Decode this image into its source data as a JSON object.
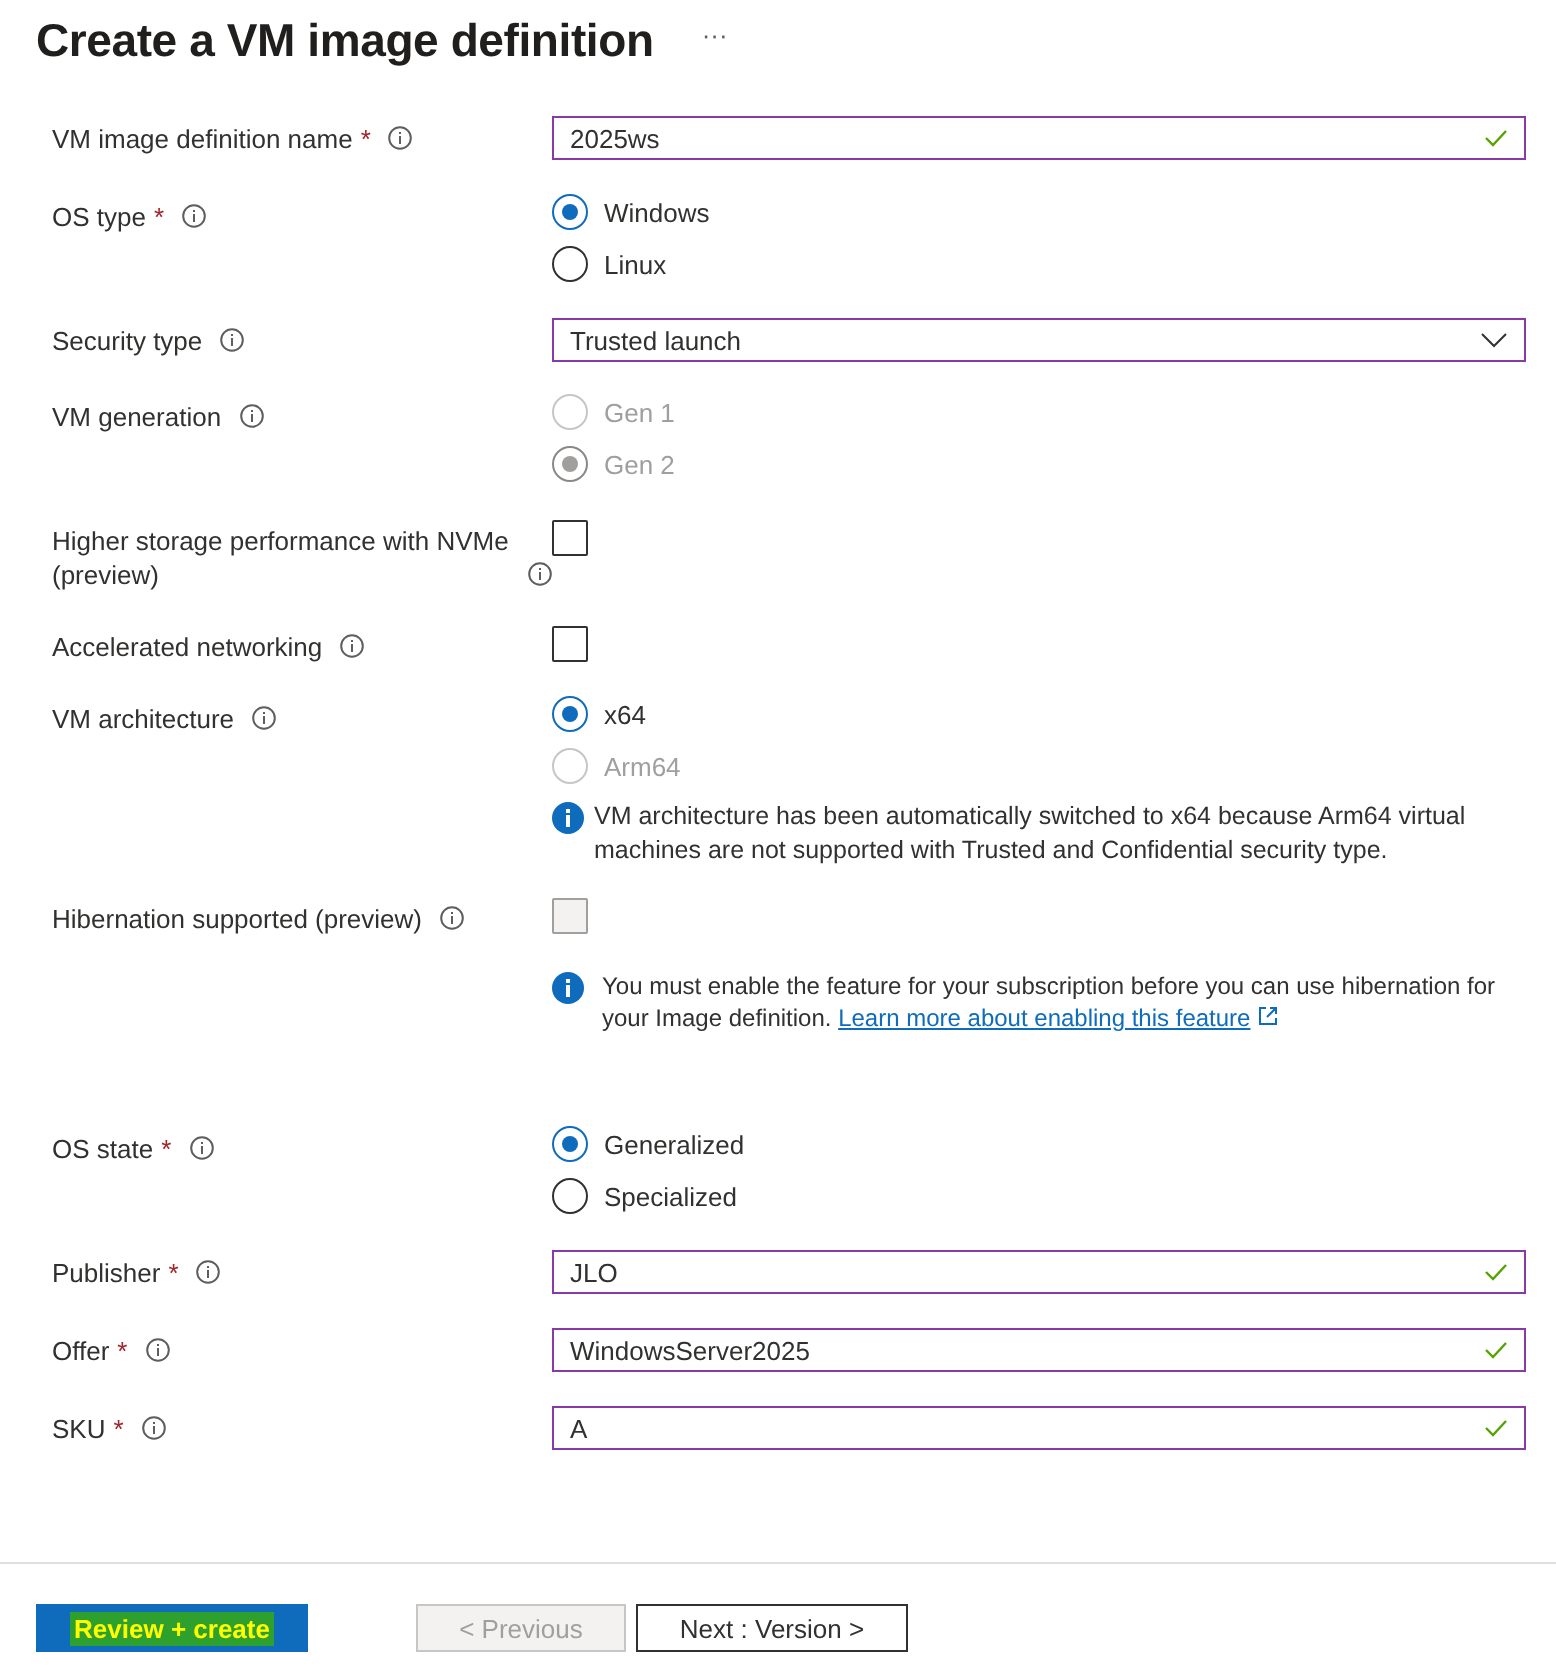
{
  "title": "Create a VM image definition",
  "more": "···",
  "fields": [
    {
      "kind": "text",
      "label": "VM image definition name",
      "required_mark": "*",
      "value": "2025ws",
      "valid": true
    },
    {
      "kind": "radio",
      "label": "OS type",
      "required_mark": "*",
      "options": [
        {
          "label": "Windows",
          "selected": true,
          "disabled": false
        },
        {
          "label": "Linux",
          "selected": false,
          "disabled": false
        }
      ]
    },
    {
      "kind": "select",
      "label": "Security type",
      "value": "Trusted launch"
    },
    {
      "kind": "radio",
      "label": "VM generation",
      "options": [
        {
          "label": "Gen 1",
          "selected": false,
          "disabled": true
        },
        {
          "label": "Gen 2",
          "selected": true,
          "disabled": true
        }
      ]
    },
    {
      "kind": "checkbox",
      "label": "Higher storage performance with NVMe (preview)",
      "checked": false,
      "disabled": false
    },
    {
      "kind": "checkbox",
      "label": "Accelerated networking",
      "checked": false,
      "disabled": false
    },
    {
      "kind": "radio",
      "label": "VM architecture",
      "options": [
        {
          "label": "x64",
          "selected": true,
          "disabled": false
        },
        {
          "label": "Arm64",
          "selected": false,
          "disabled": true
        }
      ],
      "note": {
        "text": "VM architecture has been automatically switched to x64 because Arm64 virtual machines are not supported with Trusted and Confidential security type."
      }
    },
    {
      "kind": "checkbox",
      "label": "Hibernation supported (preview)",
      "checked": false,
      "disabled": true,
      "note": {
        "text": "You must enable the feature for your subscription before you can use hibernation for your Image definition.",
        "link": "Learn more about enabling this feature"
      }
    },
    {
      "kind": "radio",
      "label": "OS state",
      "required_mark": "*",
      "options": [
        {
          "label": "Generalized",
          "selected": true,
          "disabled": false
        },
        {
          "label": "Specialized",
          "selected": false,
          "disabled": false
        }
      ]
    },
    {
      "kind": "text",
      "label": "Publisher",
      "required_mark": "*",
      "value": "JLO",
      "valid": true
    },
    {
      "kind": "text",
      "label": "Offer",
      "required_mark": "*",
      "value": "WindowsServer2025",
      "valid": true
    },
    {
      "kind": "text",
      "label": "SKU",
      "required_mark": "*",
      "value": "A",
      "valid": true
    }
  ],
  "buttons": [
    {
      "kind": "primary",
      "label": "Review + create",
      "disabled": false,
      "highlighted": true
    },
    {
      "kind": "secondary",
      "label": "< Previous",
      "disabled": true,
      "highlighted": false
    },
    {
      "kind": "secondary",
      "label": "Next : Version >",
      "disabled": false,
      "highlighted": false
    }
  ]
}
